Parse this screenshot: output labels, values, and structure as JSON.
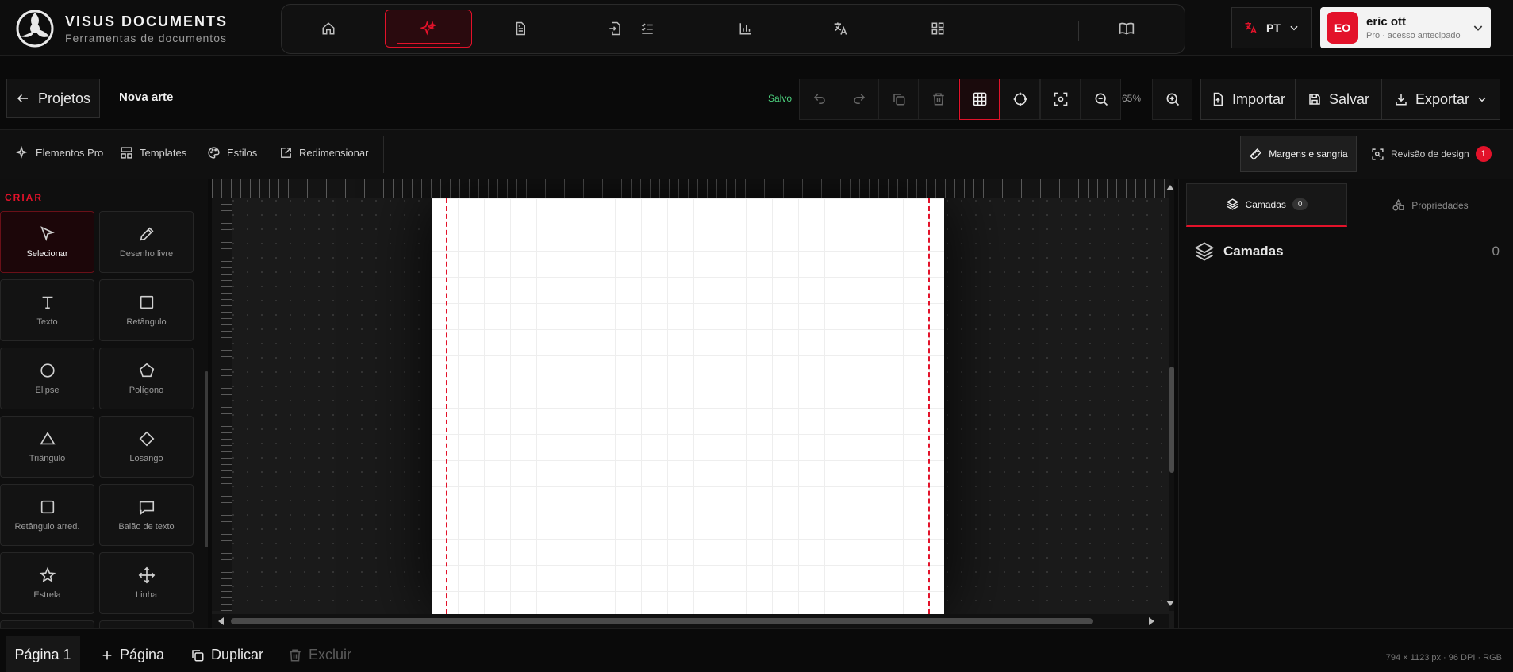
{
  "brand": {
    "title": "VISUS DOCUMENTS",
    "subtitle": "Ferramentas de documentos"
  },
  "nav": {
    "icons": [
      "home-icon",
      "sparkle-icon",
      "document-icon",
      "file-import-icon",
      "checklist-icon",
      "bar-chart-icon",
      "translate-icon",
      "grid-icon",
      "book-icon"
    ],
    "active_index": 1
  },
  "language": {
    "code": "PT"
  },
  "user": {
    "initials": "EO",
    "name": "eric ott",
    "plan": "Pro · acesso antecipado"
  },
  "toolbar": {
    "back_label": "Projetos",
    "doc_title": "Nova arte",
    "saved_label": "Salvo",
    "zoom": "65%",
    "import_label": "Importar",
    "save_label": "Salvar",
    "export_label": "Exportar"
  },
  "subbar": {
    "items": [
      "Elementos Pro",
      "Templates",
      "Estilos",
      "Redimensionar"
    ],
    "margins_label": "Margens e sangria",
    "review_label": "Revisão de design",
    "review_count": "1"
  },
  "tools": {
    "heading": "CRIAR",
    "items": [
      "Selecionar",
      "Desenho livre",
      "Texto",
      "Retângulo",
      "Elipse",
      "Polígono",
      "Triângulo",
      "Losango",
      "Retângulo arred.",
      "Balão de texto",
      "Estrela",
      "Linha"
    ]
  },
  "right_panel": {
    "tab_layers": "Camadas",
    "tab_layers_count": "0",
    "tab_properties": "Propriedades",
    "layers_title": "Camadas",
    "layers_count": "0"
  },
  "bottombar": {
    "page_tab": "Página 1",
    "add_page": "Página",
    "duplicate": "Duplicar",
    "delete": "Excluir",
    "doc_info": "794 × 1123 px · 96 DPI · RGB"
  },
  "colors": {
    "accent": "#e3122a",
    "saved": "#4cd07d",
    "background": "#0b0b0b"
  }
}
